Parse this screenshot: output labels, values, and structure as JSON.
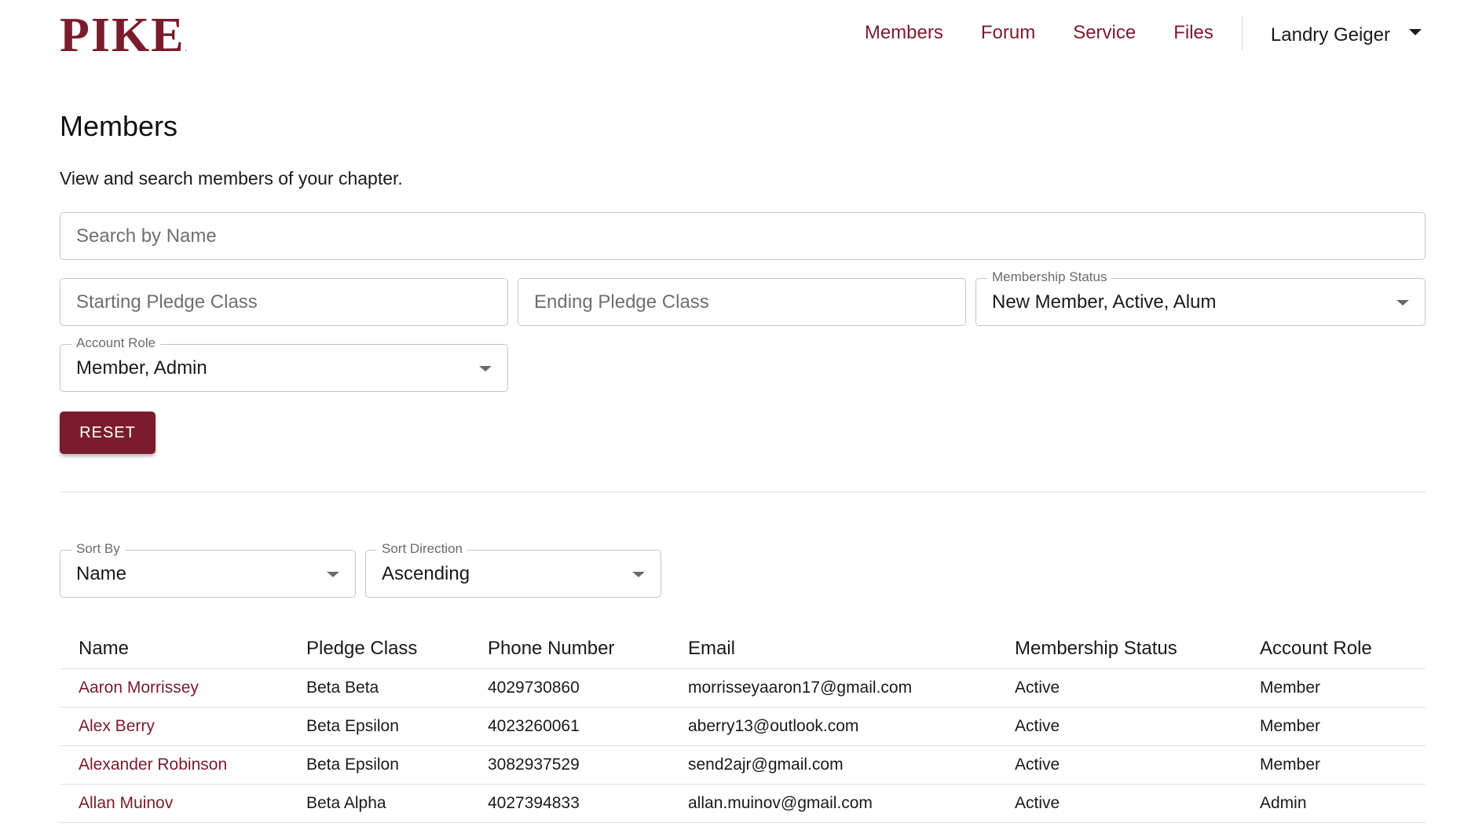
{
  "brand": {
    "logo_text": "PIKE",
    "accent_color": "#7a1c2c"
  },
  "nav": {
    "links": [
      "Members",
      "Forum",
      "Service",
      "Files"
    ],
    "user_name": "Landry Geiger"
  },
  "page": {
    "title": "Members",
    "description": "View and search members of your chapter."
  },
  "filters": {
    "search_placeholder": "Search by Name",
    "starting_pledge_class_placeholder": "Starting Pledge Class",
    "ending_pledge_class_placeholder": "Ending Pledge Class",
    "membership_status": {
      "label": "Membership Status",
      "value": "New Member, Active, Alum"
    },
    "account_role": {
      "label": "Account Role",
      "value": "Member, Admin"
    },
    "reset_label": "RESET"
  },
  "sort": {
    "sort_by": {
      "label": "Sort By",
      "value": "Name"
    },
    "sort_direction": {
      "label": "Sort Direction",
      "value": "Ascending"
    }
  },
  "table": {
    "headers": [
      "Name",
      "Pledge Class",
      "Phone Number",
      "Email",
      "Membership Status",
      "Account Role"
    ],
    "rows": [
      [
        "Aaron Morrissey",
        "Beta Beta",
        "4029730860",
        "morrisseyaaron17@gmail.com",
        "Active",
        "Member"
      ],
      [
        "Alex Berry",
        "Beta Epsilon",
        "4023260061",
        "aberry13@outlook.com",
        "Active",
        "Member"
      ],
      [
        "Alexander Robinson",
        "Beta Epsilon",
        "3082937529",
        "send2ajr@gmail.com",
        "Active",
        "Member"
      ],
      [
        "Allan Muinov",
        "Beta Alpha",
        "4027394833",
        "allan.muinov@gmail.com",
        "Active",
        "Admin"
      ]
    ]
  }
}
